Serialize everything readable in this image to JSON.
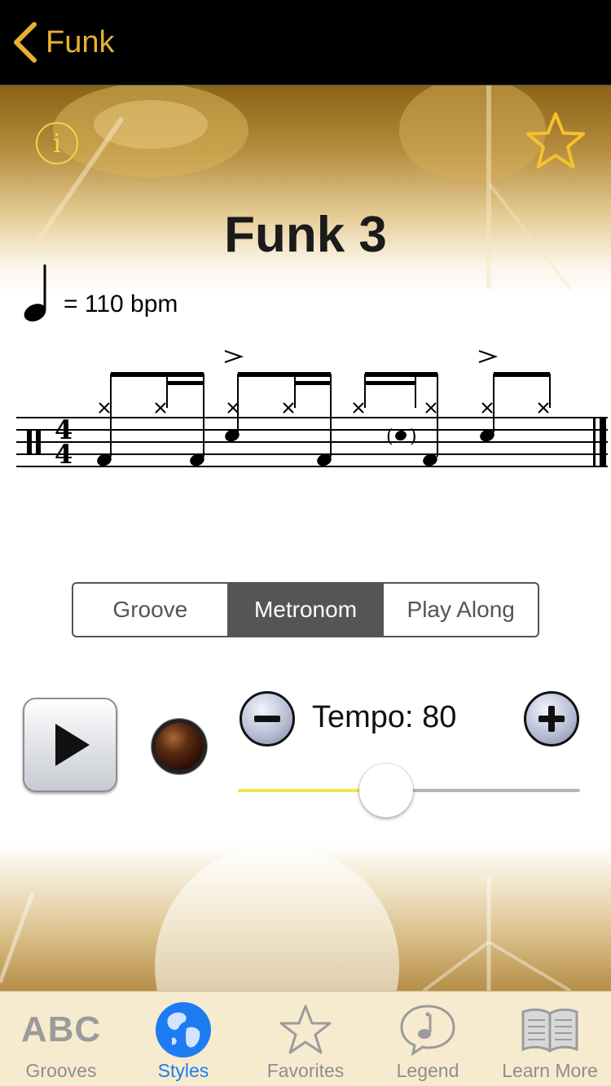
{
  "nav": {
    "back_label": "Funk"
  },
  "groove": {
    "title": "Funk 3",
    "bpm_label": "= 110 bpm",
    "time_signature": {
      "top": "4",
      "bottom": "4"
    }
  },
  "segments": [
    {
      "label": "Groove",
      "active": false
    },
    {
      "label": "Metronom",
      "active": true
    },
    {
      "label": "Play Along",
      "active": false
    }
  ],
  "tempo": {
    "label": "Tempo: 80",
    "slider_fraction": 0.42
  },
  "colors": {
    "accent_gold": "#E6B031",
    "info_yellow": "#F5D44A",
    "tab_active": "#1E7CF2",
    "slider_fill": "#F2E64C",
    "tabbar_bg": "#F6EBCE"
  },
  "tabs": [
    {
      "label": "Grooves",
      "icon_text": "ABC",
      "icon": "abc-icon",
      "active": false
    },
    {
      "label": "Styles",
      "icon": "globe-icon",
      "active": true
    },
    {
      "label": "Favorites",
      "icon": "star-icon",
      "active": false
    },
    {
      "label": "Legend",
      "icon": "speech-note-icon",
      "active": false
    },
    {
      "label": "Learn More",
      "icon": "book-icon",
      "active": false
    }
  ]
}
